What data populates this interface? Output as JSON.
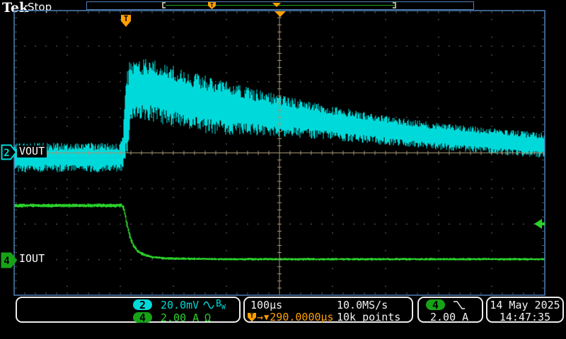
{
  "header": {
    "brand": "Tek",
    "acq_status": "Stop"
  },
  "colors": {
    "ch2": "#00d9d9",
    "ch4": "#2ad22a",
    "ch4_badge": "#17a317",
    "orange": "#ffa000",
    "graticule_border": "#4f81b8",
    "grid_dots": "#55555e",
    "center_line": "#a39674",
    "text": "#f2f2f2"
  },
  "acq_bar": {
    "trigger_icon": "T"
  },
  "trigger_marker": {
    "icon": "T"
  },
  "channels": {
    "ch2": {
      "number": "2",
      "label": "VOUT"
    },
    "ch4": {
      "number": "4",
      "label": "IOUT"
    }
  },
  "waveforms": {
    "ch2": {
      "name": "VOUT",
      "color": "#00d9d9",
      "seed": 3,
      "jbase": 0.5,
      "jvar": 0.55,
      "envelope": [
        [
          21,
          223,
          20
        ],
        [
          170,
          223,
          20
        ],
        [
          174,
          215,
          28
        ],
        [
          178,
          172,
          58
        ],
        [
          183,
          138,
          50
        ],
        [
          188,
          126,
          40
        ],
        [
          210,
          127,
          42
        ],
        [
          240,
          135,
          42
        ],
        [
          280,
          146,
          40
        ],
        [
          330,
          155,
          35
        ],
        [
          396,
          164,
          28
        ],
        [
          460,
          173,
          24
        ],
        [
          520,
          181,
          21
        ],
        [
          580,
          189,
          19
        ],
        [
          640,
          195,
          18
        ],
        [
          700,
          200,
          18
        ],
        [
          769,
          206,
          17
        ]
      ]
    },
    "ch4": {
      "name": "IOUT",
      "color": "#2ad22a",
      "seed": 7,
      "jbase": 0.4,
      "jvar": 0.6,
      "envelope": [
        [
          21,
          291,
          3
        ],
        [
          172,
          291,
          3
        ],
        [
          175,
          296,
          5
        ],
        [
          179,
          315,
          6
        ],
        [
          183,
          333,
          5
        ],
        [
          188,
          346,
          4
        ],
        [
          194,
          355,
          3
        ],
        [
          202,
          360,
          2.5
        ],
        [
          214,
          364,
          2
        ],
        [
          240,
          366,
          2
        ],
        [
          320,
          367,
          2
        ],
        [
          769,
          367,
          2
        ]
      ]
    }
  },
  "status_bar": {
    "ch2_badge": "2",
    "ch2_scale": "20.0mV",
    "ch4_badge": "4",
    "ch4_scale": "2.00 A",
    "impedance_icon": "Ω",
    "timebase": "100µs",
    "sample_rate": "10.0MS/s",
    "record_length": "10k points",
    "delay_icon_t": "T",
    "delay_arrow": "→",
    "delay_cursor": "▼",
    "delay_value": "290.0000µs",
    "trigger_badge": "4",
    "trigger_level": "2.00 A",
    "date": "14 May 2025",
    "time": "14:47:35"
  }
}
